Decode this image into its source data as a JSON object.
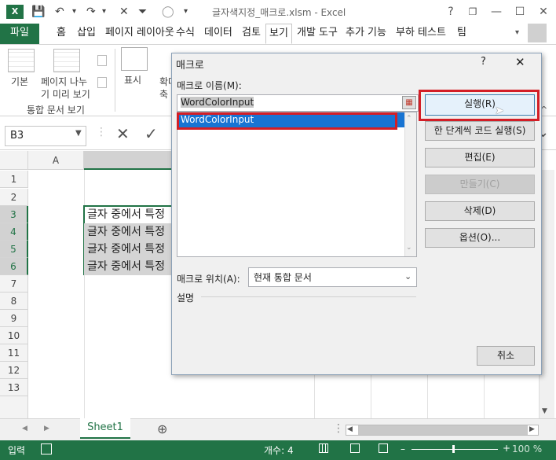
{
  "window": {
    "title": "글자색지정_매크로.xlsm - Excel",
    "help": "?",
    "restore": "❐",
    "minimize": "—",
    "maximize": "☐",
    "close": "✕"
  },
  "quick_access": {
    "save_icon": "💾",
    "undo_icon": "↶",
    "redo_icon": "↷",
    "filter_icon": "⏷",
    "circle_icon": "◯",
    "dropdown": "▾",
    "x_icon": "✕"
  },
  "ribbon_tabs": [
    {
      "label": "파일"
    },
    {
      "label": "홈"
    },
    {
      "label": "삽입"
    },
    {
      "label": "페이지 레이아웃"
    },
    {
      "label": "수식"
    },
    {
      "label": "데이터"
    },
    {
      "label": "검토"
    },
    {
      "label": "보기"
    },
    {
      "label": "개발 도구"
    },
    {
      "label": "추가 기능"
    },
    {
      "label": "부하 테스트"
    },
    {
      "label": "팀"
    }
  ],
  "ribbon": {
    "normal_label": "기본",
    "pagebreak_label_1": "페이지 나누",
    "pagebreak_label_2": "기 미리 보기",
    "group_label": "통합 문서 보기",
    "show_label": "표시",
    "zoom_label_1": "확대",
    "zoom_label_2": "축",
    "collapse": "^"
  },
  "formula_bar": {
    "name_box": "B3",
    "cancel": "✕",
    "enter": "✓"
  },
  "grid": {
    "column_headers": [
      "A"
    ],
    "row_headers": [
      "1",
      "2",
      "3",
      "4",
      "5",
      "6",
      "7",
      "8",
      "9",
      "10",
      "11",
      "12",
      "13"
    ],
    "cells": [
      "글자 중에서 특정",
      "글자 중에서 특정",
      "글자 중에서 특정",
      "글자 중에서 특정"
    ]
  },
  "sheet_tabs": {
    "active": "Sheet1",
    "add": "⊕",
    "nav_left": "◀",
    "nav_right": "▶"
  },
  "status_bar": {
    "ready": "입력",
    "count": "개수: 4",
    "zoom": "100 %"
  },
  "dialog": {
    "title": "매크로",
    "help": "?",
    "close": "✕",
    "macro_name_label": "매크로 이름(M):",
    "macro_name_value": "WordColorInput",
    "list_items": [
      "WordColorInput"
    ],
    "location_label": "매크로 위치(A):",
    "location_value": "현재 통합 문서",
    "description_label": "설명",
    "buttons": {
      "run": "실행(R)",
      "step_into": "한 단계씩 코드 실행(S)",
      "edit": "편집(E)",
      "create": "만들기(C)",
      "delete": "삭제(D)",
      "options": "옵션(O)...",
      "cancel": "취소"
    }
  }
}
